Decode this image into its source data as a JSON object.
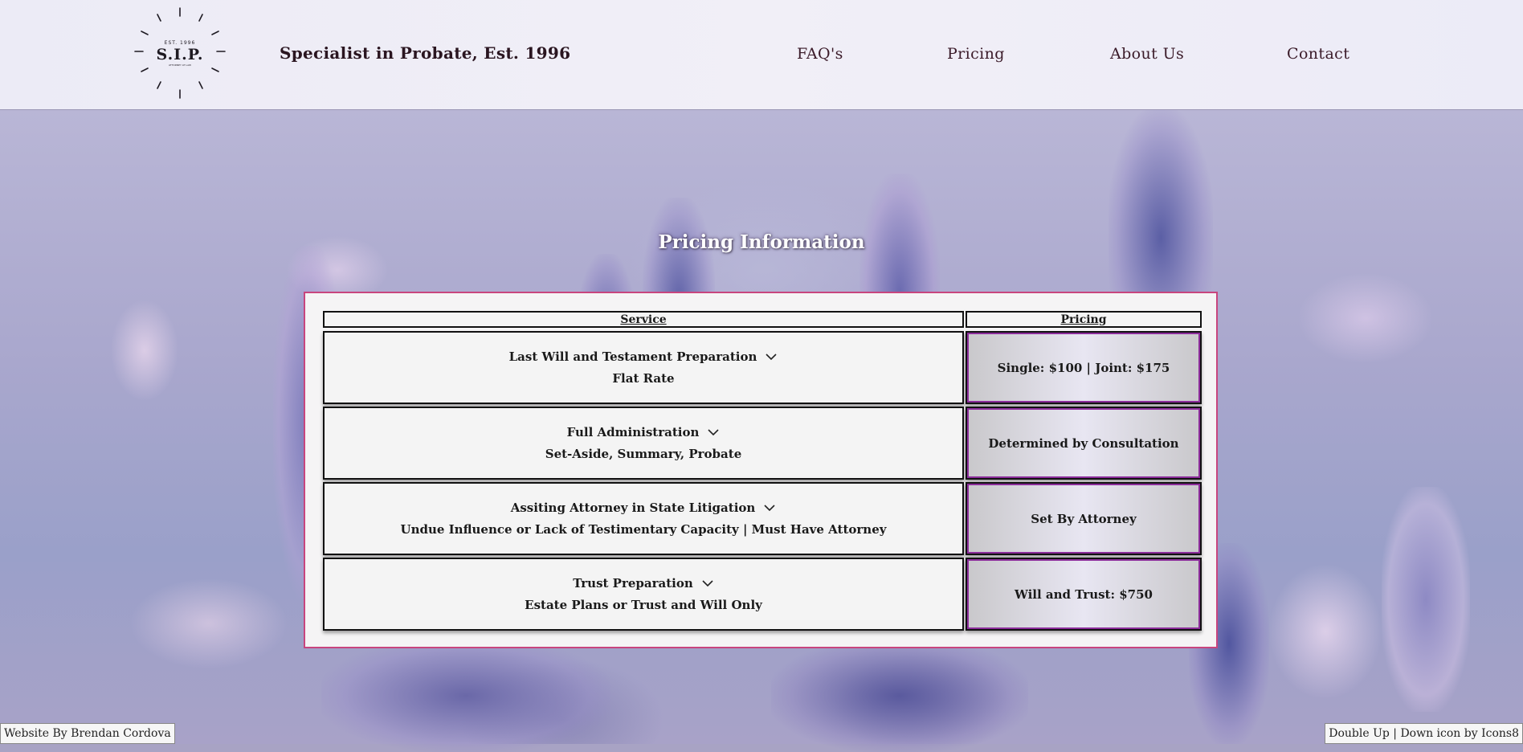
{
  "header": {
    "logo": {
      "est": "EST. 1996",
      "monogram": "S.I.P.",
      "sub": "ATTORNEY AT LAW"
    },
    "tagline": "Specialist in Probate, Est. 1996",
    "nav": [
      "FAQ's",
      "Pricing",
      "About Us",
      "Contact"
    ]
  },
  "main": {
    "title": "Pricing Information",
    "table": {
      "headers": [
        "Service",
        "Pricing"
      ],
      "rows": [
        {
          "service": "Last Will and Testament Preparation",
          "detail": "Flat Rate",
          "price": "Single: $100 | Joint: $175"
        },
        {
          "service": "Full Administration",
          "detail": "Set-Aside, Summary, Probate",
          "price": "Determined by Consultation"
        },
        {
          "service": "Assiting Attorney in State Litigation",
          "detail": "Undue Influence or Lack of Testimentary Capacity | Must Have Attorney",
          "price": "Set By Attorney"
        },
        {
          "service": "Trust Preparation",
          "detail": "Estate Plans or Trust and Will Only",
          "price": "Will and Trust: $750"
        }
      ]
    }
  },
  "footer": {
    "credit": "Website By Brendan Cordova",
    "icon_credit": "Double Up | Down icon by Icons8"
  },
  "colors": {
    "panel_border": "#c8457e",
    "price_outline": "#8b2c9a",
    "header_bg": "#efeef7"
  }
}
